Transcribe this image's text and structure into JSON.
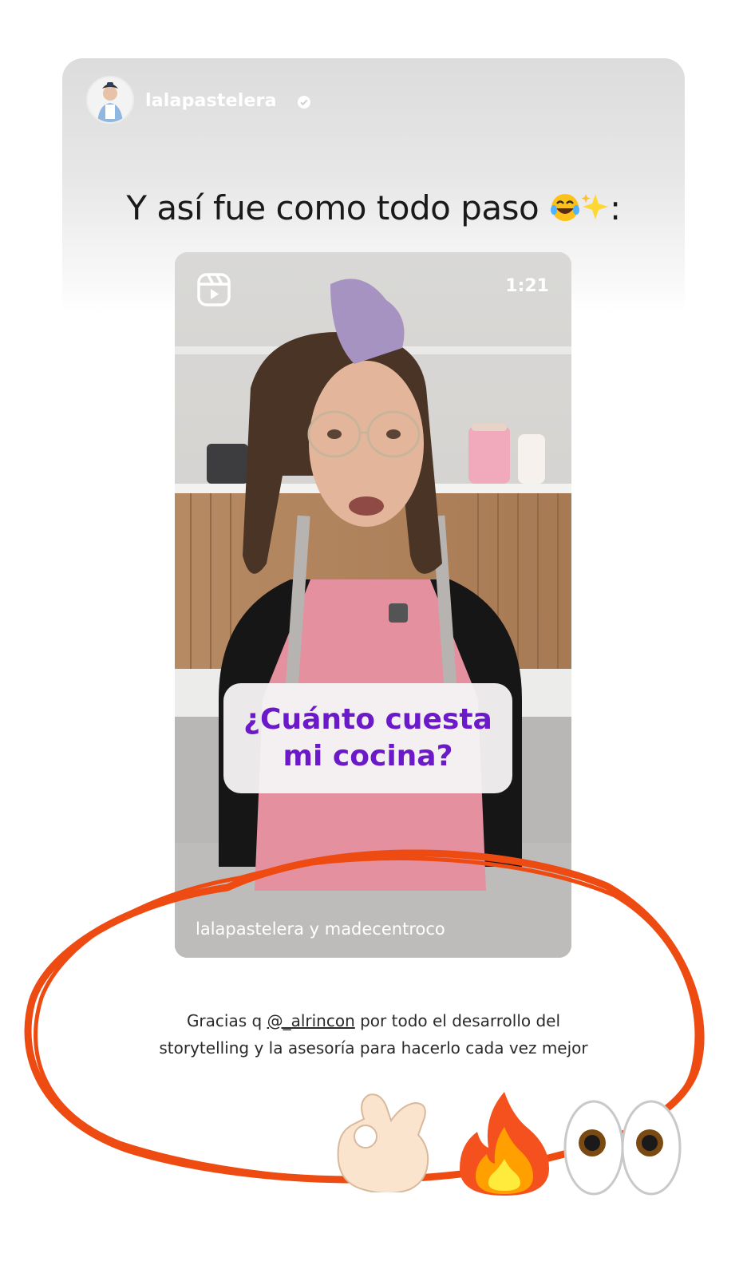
{
  "story": {
    "username": "lalapastelera",
    "headline": "Y así fue como todo paso 😂✨:",
    "headline_text": "Y así fue como todo paso",
    "headline_suffix": ":"
  },
  "reel": {
    "duration": "1:21",
    "question_line1": "¿Cuánto cuesta",
    "question_line2": "mi cocina?",
    "credit": "lalapastelera y madecentroco"
  },
  "caption": {
    "prefix": "Gracias q",
    "mention": "@_alrincon",
    "line1_rest": "por todo el desarrollo del",
    "line2": "storytelling y la asesoría para hacerlo cada vez mejor"
  },
  "colors": {
    "scribble": "#ee4b12",
    "question_text": "#6b19c9"
  },
  "icons": [
    "verified-badge-icon",
    "reels-icon",
    "ok-hand-emoji",
    "fire-emoji",
    "eyes-emoji",
    "laughing-emoji",
    "sparkles-emoji"
  ]
}
